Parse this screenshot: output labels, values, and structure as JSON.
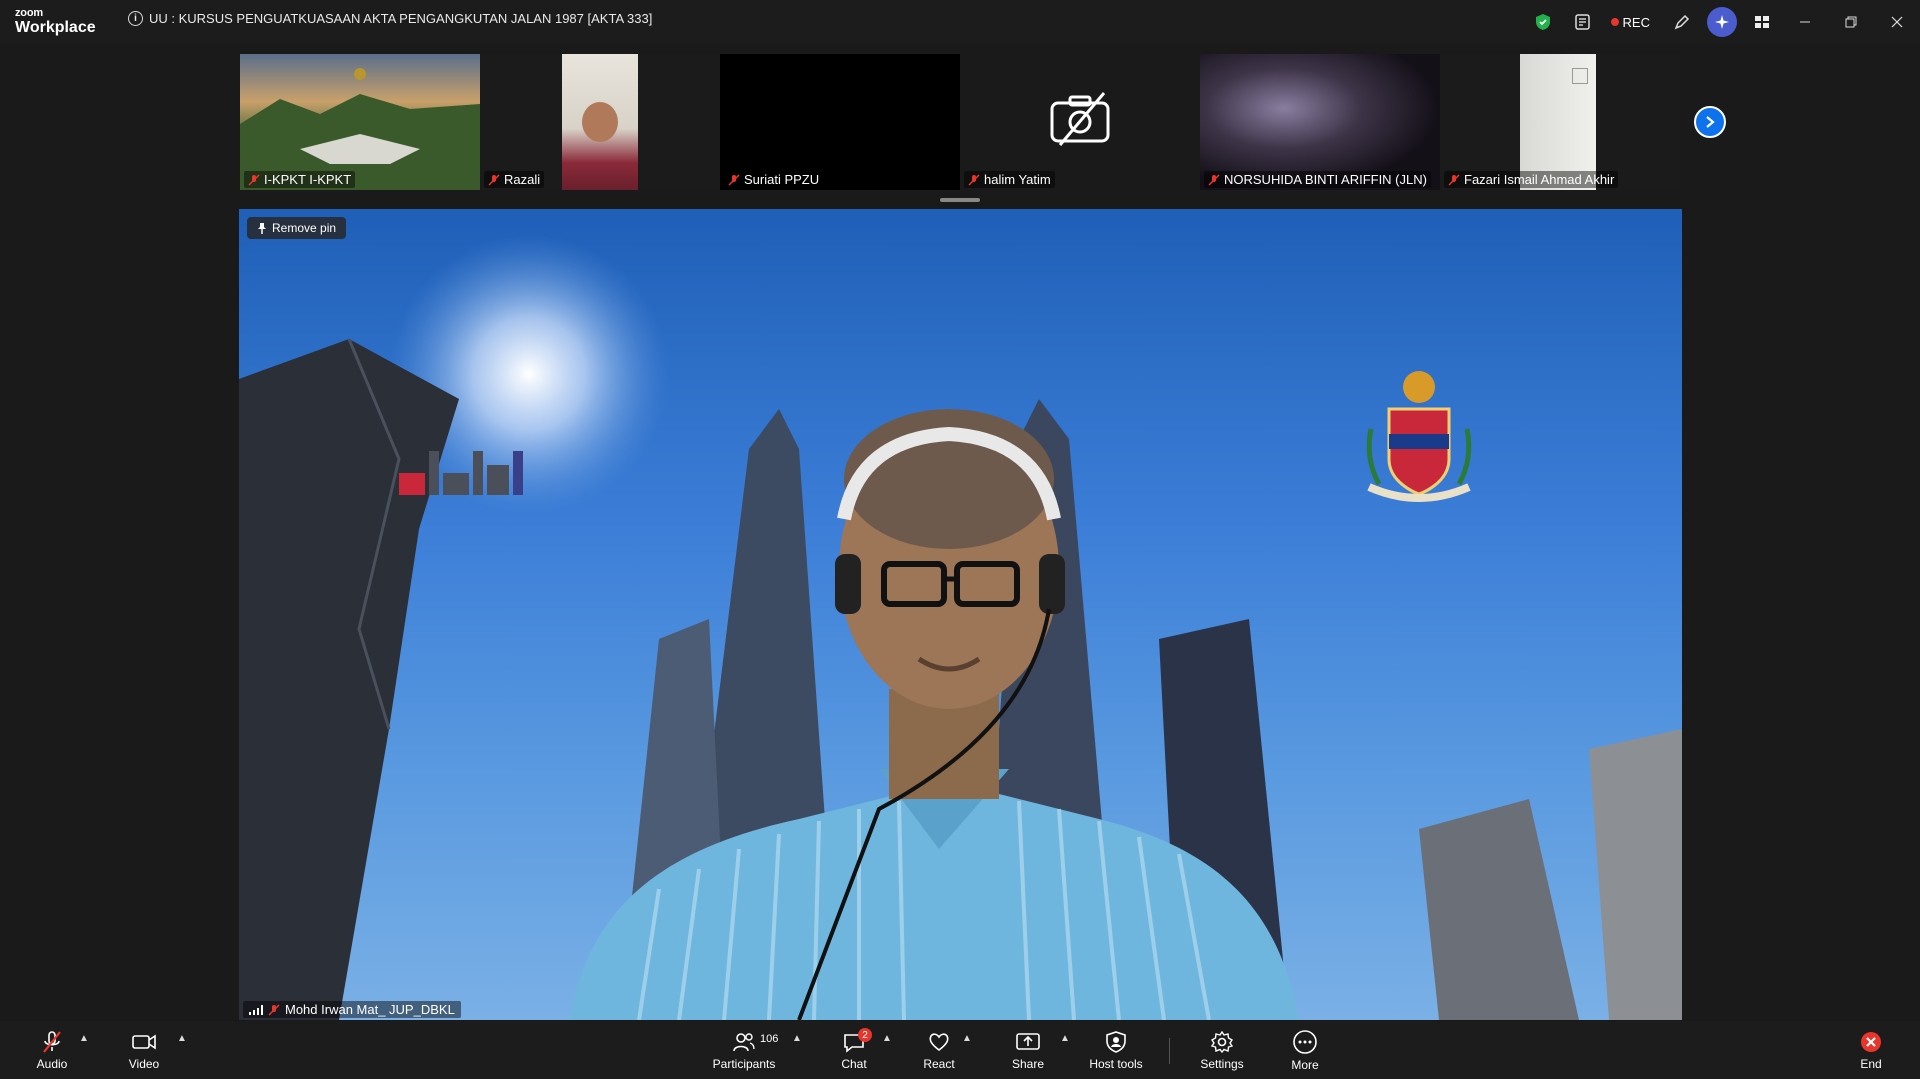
{
  "app": {
    "logo_top": "zoom",
    "logo_bottom": "Workplace"
  },
  "meeting": {
    "title": "UU : KURSUS PENGUATKUASAAN AKTA PENGANGKUTAN JALAN 1987 [AKTA 333]"
  },
  "titlebar": {
    "rec_label": "REC"
  },
  "thumbnails": [
    {
      "name": "I-KPKT I-KPKT"
    },
    {
      "name": "Razali"
    },
    {
      "name": "Suriati PPZU"
    },
    {
      "name": "halim Yatim"
    },
    {
      "name": "NORSUHIDA BINTI ARIFFIN (JLN)"
    },
    {
      "name": "Fazari Ismail Ahmad Akhir"
    }
  ],
  "main": {
    "pin_label": "Remove pin",
    "speaker_name": "Mohd Irwan Mat_ JUP_DBKL",
    "backdrop_logo": "dbkl"
  },
  "toolbar": {
    "audio": "Audio",
    "video": "Video",
    "participants": "Participants",
    "participants_count": "106",
    "chat": "Chat",
    "chat_badge": "2",
    "react": "React",
    "share": "Share",
    "host_tools": "Host tools",
    "settings": "Settings",
    "more": "More",
    "end": "End"
  },
  "colors": {
    "accent": "#0e72ed",
    "alert": "#e8362d",
    "security_green": "#22b14c"
  }
}
